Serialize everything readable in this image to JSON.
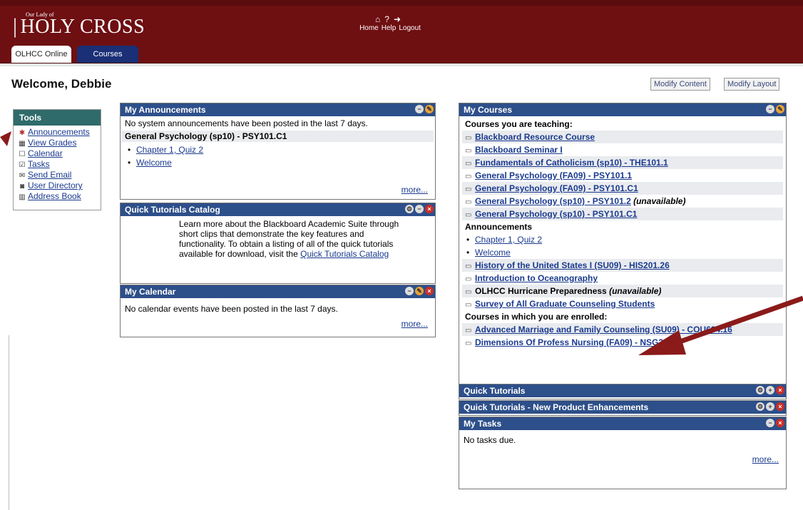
{
  "header": {
    "logo_small": "Our Lady of",
    "logo_main": "HOLY CROSS",
    "nav": [
      "Home",
      "Help",
      "Logout"
    ],
    "tabs": [
      "OLHCC Online",
      "Courses"
    ]
  },
  "page": {
    "welcome": "Welcome, Debbie",
    "modify_content": "Modify Content",
    "modify_layout": "Modify Layout"
  },
  "tools": {
    "title": "Tools",
    "items": [
      "Announcements",
      "View Grades",
      "Calendar",
      "Tasks",
      "Send Email",
      "User Directory",
      "Address Book"
    ]
  },
  "announcements": {
    "title": "My Announcements",
    "none_text": "No system announcements have been posted in the last 7 days.",
    "course": "General Psychology (sp10) - PSY101.C1",
    "items": [
      "Chapter 1, Quiz 2",
      "Welcome"
    ],
    "more": "more..."
  },
  "quick_tutorials_catalog": {
    "title": "Quick Tutorials Catalog",
    "text": "Learn more about the Blackboard Academic Suite through short clips that demonstrate the key features and functionality. To obtain a listing of all of the quick tutorials available for download, visit the",
    "link": "Quick Tutorials Catalog"
  },
  "calendar": {
    "title": "My Calendar",
    "text": "No calendar events have been posted in the last 7 days.",
    "more": "more..."
  },
  "my_courses": {
    "title": "My Courses",
    "teaching_heading": "Courses you are teaching:",
    "teaching": [
      "Blackboard Resource Course",
      "Blackboard Seminar I",
      "Fundamentals of Catholicism (sp10) - THE101.1",
      "General Psychology (FA09) - PSY101.1",
      "General Psychology (FA09) - PSY101.C1",
      "General Psychology (sp10) - PSY101.2",
      "General Psychology (sp10) - PSY101.C1"
    ],
    "unavailable": "(unavailable)",
    "announcements_heading": "Announcements",
    "announcements": [
      "Chapter 1, Quiz 2",
      "Welcome"
    ],
    "teaching_more": [
      "History of the United States I (SU09) - HIS201.26",
      "Introduction to Oceanography",
      "OLHCC Hurricane Preparedness",
      "Survey of All Graduate Counseling Students"
    ],
    "enrolled_heading": "Courses in which you are enrolled:",
    "enrolled": [
      "Advanced Marriage and Family Counseling (SU09) - COU634.16",
      "Dimensions Of Profess Nursing (FA09) - NSG200.1"
    ]
  },
  "quick_tutorials": {
    "title": "Quick Tutorials"
  },
  "quick_tutorials_np": {
    "title": "Quick Tutorials - New Product Enhancements"
  },
  "tasks": {
    "title": "My Tasks",
    "text": "No tasks due.",
    "more": "more..."
  },
  "colors": {
    "header": "#6e0f12",
    "module_header": "#2d4f8a",
    "tools_header": "#2f6b6a",
    "arrow": "#8b1a1a",
    "link": "#1a3a8f"
  }
}
